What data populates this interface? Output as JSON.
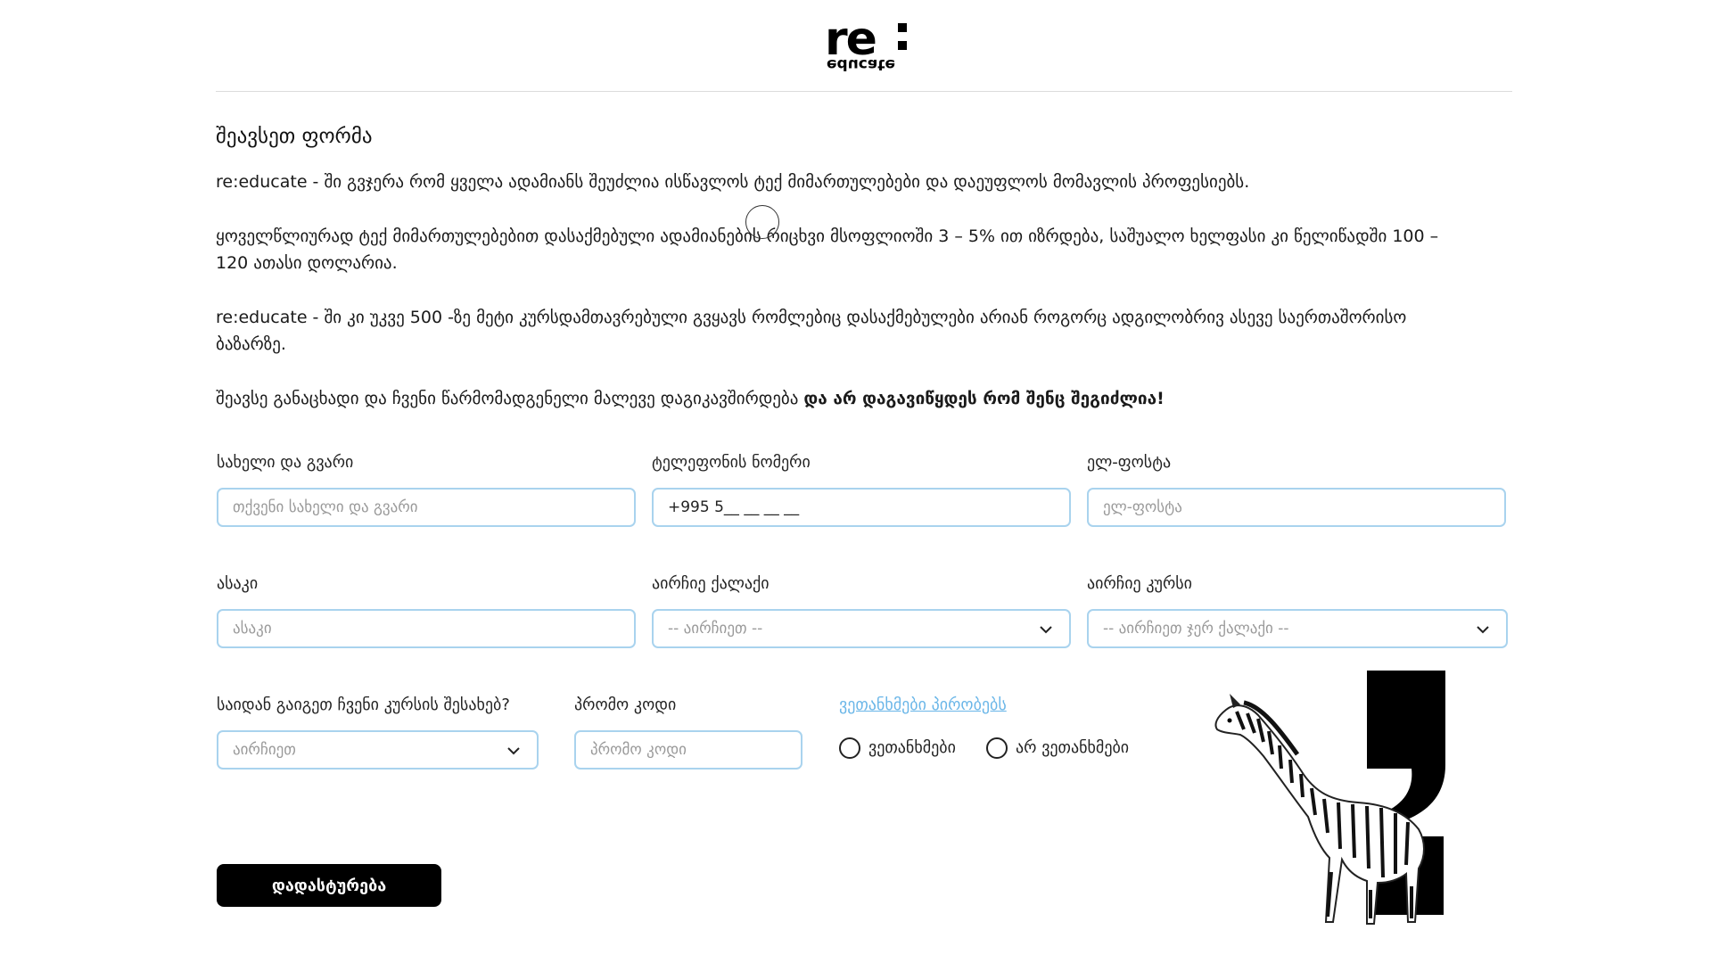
{
  "header": {
    "logo_main": "re",
    "logo_sub": "educate"
  },
  "form_title": "შეავსეთ ფორმა",
  "intro": {
    "p1": "re:educate - ში გვჯერა რომ ყველა ადამიანს შეუძლია ისწავლოს ტექ მიმართულებები და დაეუფლოს მომავლის პროფესიებს.",
    "p2": "ყოველწლიურად ტექ მიმართულებებით დასაქმებული ადამიანების რიცხვი მსოფლიოში 3 – 5% ით იზრდება, საშუალო ხელფასი კი წელიწადში 100 – 120 ათასი დოლარია.",
    "p3": "re:educate - ში კი უკვე 500 -ზე მეტი კურსდამთავრებული გვყავს რომლებიც დასაქმებულები არიან როგორც ადგილობრივ ასევე საერთაშორისო ბაზარზე.",
    "p4_normal": "შეავსე განაცხადი და ჩვენი წარმომადგენელი მალევე დაგიკავშირდება ",
    "p4_bold": "და არ დაგავიწყდეს რომ შენც შეგიძლია!"
  },
  "fields": {
    "name": {
      "label": "სახელი და გვარი",
      "placeholder": "თქვენი სახელი და გვარი"
    },
    "phone": {
      "label": "ტელეფონის ნომერი",
      "value": "+995 5__ __ __ __"
    },
    "email": {
      "label": "ელ-ფოსტა",
      "placeholder": "ელ-ფოსტა"
    },
    "age": {
      "label": "ასაკი",
      "placeholder": "ასაკი"
    },
    "city": {
      "label": "აირჩიე ქალაქი",
      "selected": "-- აირჩიეთ --"
    },
    "course": {
      "label": "აირჩიე კურსი",
      "selected": "-- აირჩიეთ ჯერ ქალაქი --"
    },
    "source": {
      "label": "საიდან გაიგეთ ჩვენი კურსის შესახებ?",
      "selected": "აირჩიეთ"
    },
    "promo": {
      "label": "პრომო კოდი",
      "placeholder": "პრომო კოდი"
    }
  },
  "terms": {
    "link": "ვეთანხმები პირობებს",
    "agree": "ვეთანხმები",
    "disagree": "არ ვეთანხმები"
  },
  "submit_label": "დადასტურება",
  "colors": {
    "field_border": "#a9d3ee",
    "link": "#6ab6e8",
    "button": "#000000"
  },
  "icons": {
    "dropdown": "chevron-down-icon",
    "decoration": "zebra-illustration"
  }
}
